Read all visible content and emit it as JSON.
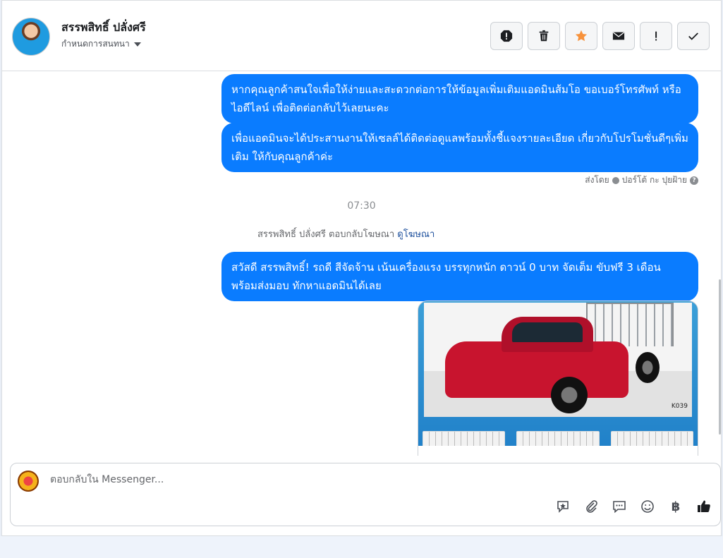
{
  "header": {
    "contact_name": "สรรพสิทธิ์ ปลั่งศรี",
    "assign_label": "กำหนดการสนทนา"
  },
  "messages": [
    {
      "text": "หากคุณลูกค้าสนใจเพื่อให้ง่ายและสะดวกต่อการให้ข้อมูลเพิ่มเติมแอดมินส้มโอ ขอเบอร์โทรศัพท์ หรือ ไอดีไลน์ เพื่อติดต่อกลับไว้เลยนะคะ"
    },
    {
      "text": "เพื่อแอดมินจะได้ประสานงานให้เซลล์ได้ติดต่อดูแลพร้อมทั้งชี้แจงรายละเอียด เกี่ยวกับโปรโมชั่นดีๆเพิ่มเติม ให้กับคุณลูกค้าค่ะ"
    },
    {
      "text": "สวัสดี สรรพสิทธิ์! รถดี สีจัดจ้าน เน้นเครื่องแรง บรรทุกหนัก ดาวน์ 0 บาท จัดเต็ม ขับฟรี 3 เดือน พร้อมส่งมอบ ทักหาแอดมินได้เลย"
    }
  ],
  "sent_by": {
    "prefix": "ส่งโดย",
    "name": "ปอร์โต้ กะ ปุยฝ้าย"
  },
  "timestamp": "07:30",
  "ad_reply": {
    "text": "สรรพสิทธิ์ ปลั่งศรี ตอบกลับโฆษณา",
    "link": "ดูโฆษณา"
  },
  "ad_card": {
    "image_code": "K039"
  },
  "composer": {
    "placeholder": "ตอบกลับใน Messenger..."
  },
  "toolbar_icons": [
    "exclamation-circle-icon",
    "trash-icon",
    "star-icon",
    "envelope-icon",
    "exclamation-icon",
    "check-icon"
  ],
  "composer_icons": [
    "saved-reply-icon",
    "attachment-icon",
    "chat-bubble-icon",
    "emoji-icon",
    "baht-icon",
    "thumbs-up-icon"
  ],
  "colors": {
    "bubble": "#0a7cff",
    "star": "#f7923b",
    "link": "#1c4f9c"
  }
}
